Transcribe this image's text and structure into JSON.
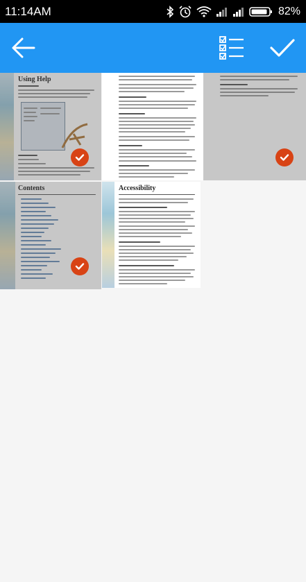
{
  "status_bar": {
    "time": "11:14AM",
    "battery_percent": "82%",
    "icons": [
      "bluetooth-icon",
      "alarm-icon",
      "wifi-icon",
      "signal-icon",
      "signal-icon",
      "battery-icon"
    ]
  },
  "app_bar": {
    "color": "#2196f3",
    "actions": [
      "back-arrow-icon",
      "select-all-icon",
      "checkmark-icon"
    ]
  },
  "thumbnails": [
    {
      "title": "Using Help",
      "selected": true
    },
    {
      "title": "",
      "selected": false
    },
    {
      "title": "",
      "selected": true
    },
    {
      "title": "Contents",
      "selected": true
    },
    {
      "title": "Accessibility",
      "selected": false
    }
  ],
  "colors": {
    "accent": "#2196f3",
    "check_badge": "#d84315"
  }
}
